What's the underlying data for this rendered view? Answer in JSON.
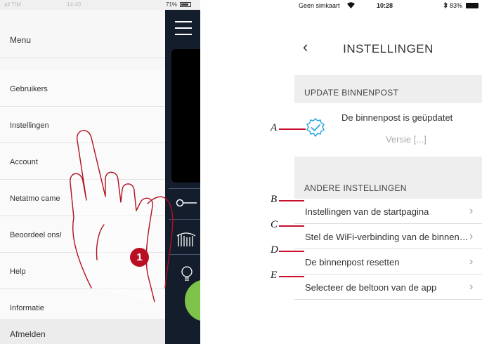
{
  "left_screen": {
    "status": {
      "carrier": "all TIM",
      "time": "14:40",
      "battery": "71%"
    },
    "menu": {
      "title": "Menu",
      "items": [
        {
          "label": "Gebruikers"
        },
        {
          "label": "Instellingen"
        },
        {
          "label": "Account"
        },
        {
          "label": "Netatmo came"
        },
        {
          "label": "Beoordeel ons!"
        },
        {
          "label": "Help"
        },
        {
          "label": "Informatie"
        }
      ],
      "logout_label": "Afmelden"
    },
    "step_badge": "1",
    "colors": {
      "badge": "#b90f22",
      "app_bg": "#141d2c",
      "accent_green": "#7ec24b"
    }
  },
  "right_screen": {
    "status": {
      "carrier": "Geen simkaart",
      "time": "10:28",
      "battery": "83%"
    },
    "title": "INSTELLINGEN",
    "update_section": {
      "header": "UPDATE BINNENPOST",
      "message": "De binnenpost is geüpdatet",
      "version": "Versie [...]"
    },
    "other_section": {
      "header": "ANDERE INSTELLINGEN",
      "rows": [
        {
          "label": "Instellingen van de startpagina"
        },
        {
          "label": "Stel de WiFi-verbinding van de binnenpost in"
        },
        {
          "label": "De binnenpost resetten"
        },
        {
          "label": "Selecteer de beltoon van de app"
        }
      ]
    },
    "callouts": [
      "A",
      "B",
      "C",
      "D",
      "E"
    ],
    "colors": {
      "callout_line": "#c8102e",
      "gear": "#2aa6e0"
    }
  }
}
